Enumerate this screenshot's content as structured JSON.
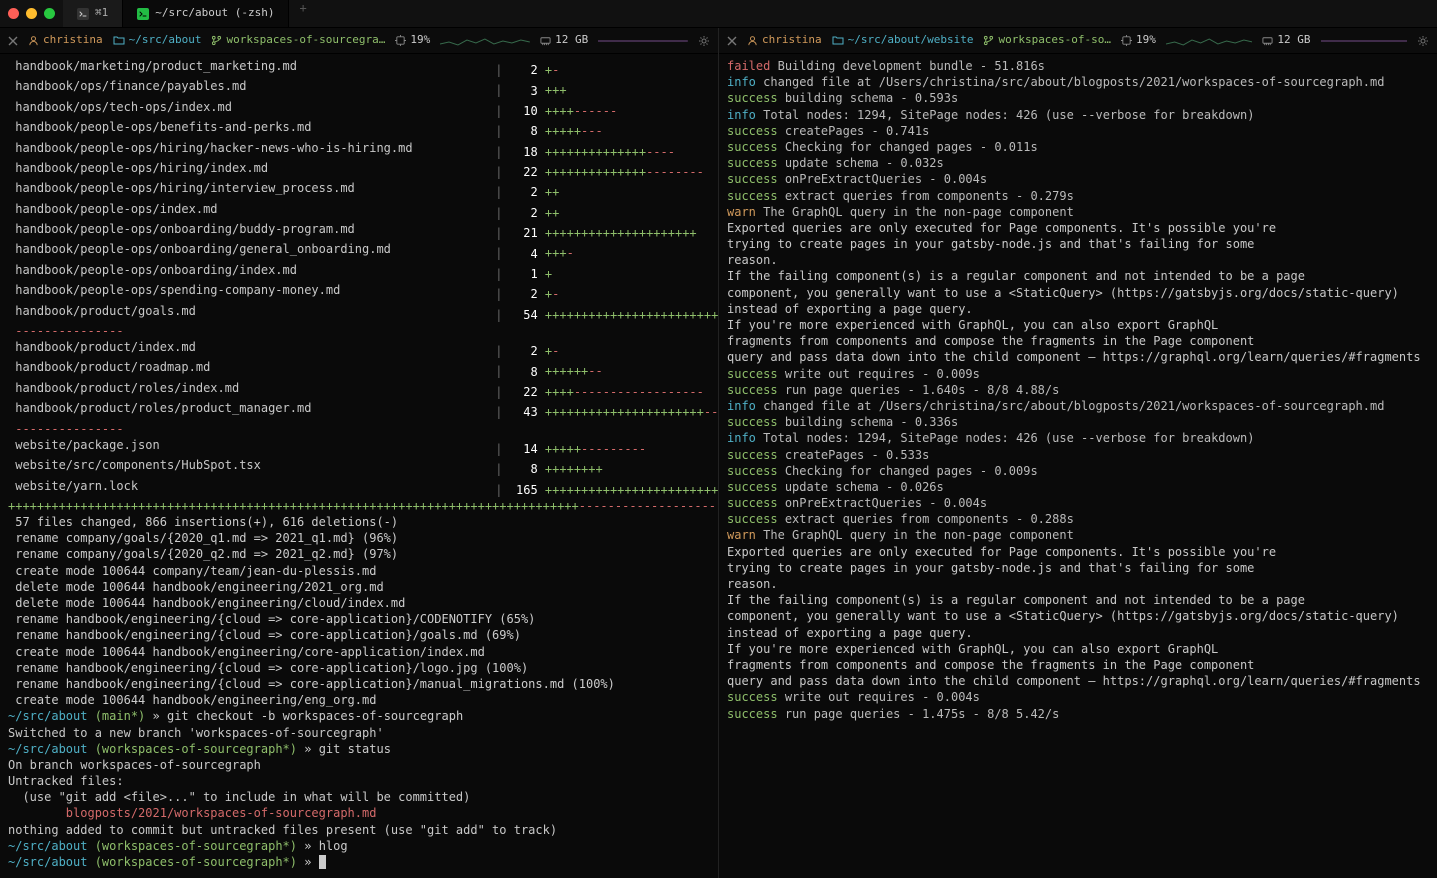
{
  "window": {
    "tabs": [
      {
        "icon": "terminal",
        "label": "⌘1"
      },
      {
        "icon": "terminal-green",
        "label": "~/src/about (-zsh)"
      }
    ],
    "active_tab": 1
  },
  "panes": {
    "left": {
      "status": {
        "user": "christina",
        "path": "~/src/about",
        "branch": "workspaces-of-sourcegra…",
        "cpu": "19%",
        "mem": "12 GB"
      },
      "diff_rows": [
        {
          "path": "handbook/marketing/product_marketing.md",
          "n": 2,
          "p": 1,
          "m": 1
        },
        {
          "path": "handbook/ops/finance/payables.md",
          "n": 3,
          "p": 3,
          "m": 0
        },
        {
          "path": "handbook/ops/tech-ops/index.md",
          "n": 10,
          "p": 4,
          "m": 6
        },
        {
          "path": "handbook/people-ops/benefits-and-perks.md",
          "n": 8,
          "p": 5,
          "m": 3
        },
        {
          "path": "handbook/people-ops/hiring/hacker-news-who-is-hiring.md",
          "n": 18,
          "p": 14,
          "m": 4
        },
        {
          "path": "handbook/people-ops/hiring/index.md",
          "n": 22,
          "p": 14,
          "m": 8
        },
        {
          "path": "handbook/people-ops/hiring/interview_process.md",
          "n": 2,
          "p": 2,
          "m": 0
        },
        {
          "path": "handbook/people-ops/index.md",
          "n": 2,
          "p": 2,
          "m": 0
        },
        {
          "path": "handbook/people-ops/onboarding/buddy-program.md",
          "n": 21,
          "p": 21,
          "m": 0
        },
        {
          "path": "handbook/people-ops/onboarding/general_onboarding.md",
          "n": 4,
          "p": 3,
          "m": 1
        },
        {
          "path": "handbook/people-ops/onboarding/index.md",
          "n": 1,
          "p": 1,
          "m": 0
        },
        {
          "path": "handbook/people-ops/spending-company-money.md",
          "n": 2,
          "p": 1,
          "m": 1
        },
        {
          "path": "handbook/product/goals.md",
          "n": 54,
          "p": 27,
          "m": 27
        }
      ],
      "diff_rows2": [
        {
          "path": "handbook/product/index.md",
          "n": 2,
          "p": 1,
          "m": 1
        },
        {
          "path": "handbook/product/roadmap.md",
          "n": 8,
          "p": 6,
          "m": 2
        },
        {
          "path": "handbook/product/roles/index.md",
          "n": 22,
          "p": 4,
          "m": 18
        },
        {
          "path": "handbook/product/roles/product_manager.md",
          "n": 43,
          "p": 22,
          "m": 21
        }
      ],
      "diff_rows3": [
        {
          "path": "website/package.json",
          "n": 14,
          "p": 5,
          "m": 9
        },
        {
          "path": "website/src/components/HubSpot.tsx",
          "n": 8,
          "p": 8,
          "m": 0
        },
        {
          "path": "website/yarn.lock",
          "n": 165,
          "p": 30,
          "m": 10
        }
      ],
      "sep_dashes": "---------------",
      "long_bar_plus": "+++++++++++++++++++++++++++++++++++++++++++++++++++++++++++++++++++++++++++++++",
      "long_bar_minus": "---------------------",
      "summary_lines": [
        " 57 files changed, 866 insertions(+), 616 deletions(-)",
        " rename company/goals/{2020_q1.md => 2021_q1.md} (96%)",
        " rename company/goals/{2020_q2.md => 2021_q2.md} (97%)",
        " create mode 100644 company/team/jean-du-plessis.md",
        " delete mode 100644 handbook/engineering/2021_org.md",
        " delete mode 100644 handbook/engineering/cloud/index.md",
        " rename handbook/engineering/{cloud => core-application}/CODENOTIFY (65%)",
        " rename handbook/engineering/{cloud => core-application}/goals.md (69%)",
        " create mode 100644 handbook/engineering/core-application/index.md",
        " rename handbook/engineering/{cloud => core-application}/logo.jpg (100%)",
        " rename handbook/engineering/{cloud => core-application}/manual_migrations.md (100%)",
        " create mode 100644 handbook/engineering/eng_org.md"
      ],
      "prompts": [
        {
          "path": "~/src/about",
          "branch": "main*",
          "cmd": "git checkout -b workspaces-of-sourcegraph"
        },
        {
          "plain": "Switched to a new branch 'workspaces-of-sourcegraph'"
        },
        {
          "path": "~/src/about",
          "branch": "workspaces-of-sourcegraph*",
          "cmd": "git status"
        },
        {
          "plain": "On branch workspaces-of-sourcegraph"
        },
        {
          "plain": "Untracked files:"
        },
        {
          "plain": "  (use \"git add <file>...\" to include in what will be committed)"
        },
        {
          "untracked": "        blogposts/2021/workspaces-of-sourcegraph.md"
        },
        {
          "plain": ""
        },
        {
          "plain": "nothing added to commit but untracked files present (use \"git add\" to track)"
        },
        {
          "path": "~/src/about",
          "branch": "workspaces-of-sourcegraph*",
          "cmd": "hlog"
        },
        {
          "path": "~/src/about",
          "branch": "workspaces-of-sourcegraph*",
          "cmd": "",
          "cursor": true
        }
      ]
    },
    "right": {
      "status": {
        "user": "christina",
        "path": "~/src/about/website",
        "branch": "workspaces-of-so…",
        "cpu": "19%",
        "mem": "12 GB"
      },
      "log": [
        {
          "lbl": "failed",
          "msg": "Building development bundle - 51.816s"
        },
        {
          "lbl": "info",
          "msg": "changed file at /Users/christina/src/about/blogposts/2021/workspaces-of-sourcegraph.md"
        },
        {
          "lbl": "success",
          "msg": "building schema - 0.593s"
        },
        {
          "lbl": "info",
          "msg": "Total nodes: 1294, SitePage nodes: 426 (use --verbose for breakdown)"
        },
        {
          "lbl": "success",
          "msg": "createPages - 0.741s"
        },
        {
          "lbl": "success",
          "msg": "Checking for changed pages - 0.011s"
        },
        {
          "lbl": "success",
          "msg": "update schema - 0.032s"
        },
        {
          "lbl": "success",
          "msg": "onPreExtractQueries - 0.004s"
        },
        {
          "lbl": "success",
          "msg": "extract queries from components - 0.279s"
        },
        {
          "lbl": "warn",
          "msg": "The GraphQL query in the non-page component"
        },
        {
          "msg": "Exported queries are only executed for Page components. It's possible you're"
        },
        {
          "msg": "trying to create pages in your gatsby-node.js and that's failing for some"
        },
        {
          "msg": "reason."
        },
        {
          "msg": ""
        },
        {
          "msg": "If the failing component(s) is a regular component and not intended to be a page"
        },
        {
          "msg": "component, you generally want to use a <StaticQuery> (https://gatsbyjs.org/docs/static-query)"
        },
        {
          "msg": "instead of exporting a page query."
        },
        {
          "msg": ""
        },
        {
          "msg": "If you're more experienced with GraphQL, you can also export GraphQL"
        },
        {
          "msg": "fragments from components and compose the fragments in the Page component"
        },
        {
          "msg": "query and pass data down into the child component — https://graphql.org/learn/queries/#fragments"
        },
        {
          "lbl": "success",
          "msg": "write out requires - 0.009s"
        },
        {
          "lbl": "success",
          "msg": "run page queries - 1.640s - 8/8 4.88/s"
        },
        {
          "lbl": "info",
          "msg": "changed file at /Users/christina/src/about/blogposts/2021/workspaces-of-sourcegraph.md"
        },
        {
          "lbl": "success",
          "msg": "building schema - 0.336s"
        },
        {
          "lbl": "info",
          "msg": "Total nodes: 1294, SitePage nodes: 426 (use --verbose for breakdown)"
        },
        {
          "lbl": "success",
          "msg": "createPages - 0.533s"
        },
        {
          "lbl": "success",
          "msg": "Checking for changed pages - 0.009s"
        },
        {
          "lbl": "success",
          "msg": "update schema - 0.026s"
        },
        {
          "lbl": "success",
          "msg": "onPreExtractQueries - 0.004s"
        },
        {
          "lbl": "success",
          "msg": "extract queries from components - 0.288s"
        },
        {
          "lbl": "warn",
          "msg": "The GraphQL query in the non-page component"
        },
        {
          "msg": "Exported queries are only executed for Page components. It's possible you're"
        },
        {
          "msg": "trying to create pages in your gatsby-node.js and that's failing for some"
        },
        {
          "msg": "reason."
        },
        {
          "msg": ""
        },
        {
          "msg": "If the failing component(s) is a regular component and not intended to be a page"
        },
        {
          "msg": "component, you generally want to use a <StaticQuery> (https://gatsbyjs.org/docs/static-query)"
        },
        {
          "msg": "instead of exporting a page query."
        },
        {
          "msg": ""
        },
        {
          "msg": "If you're more experienced with GraphQL, you can also export GraphQL"
        },
        {
          "msg": "fragments from components and compose the fragments in the Page component"
        },
        {
          "msg": "query and pass data down into the child component — https://graphql.org/learn/queries/#fragments"
        },
        {
          "lbl": "success",
          "msg": "write out requires - 0.004s"
        },
        {
          "lbl": "success",
          "msg": "run page queries - 1.475s - 8/8 5.42/s"
        }
      ]
    }
  }
}
